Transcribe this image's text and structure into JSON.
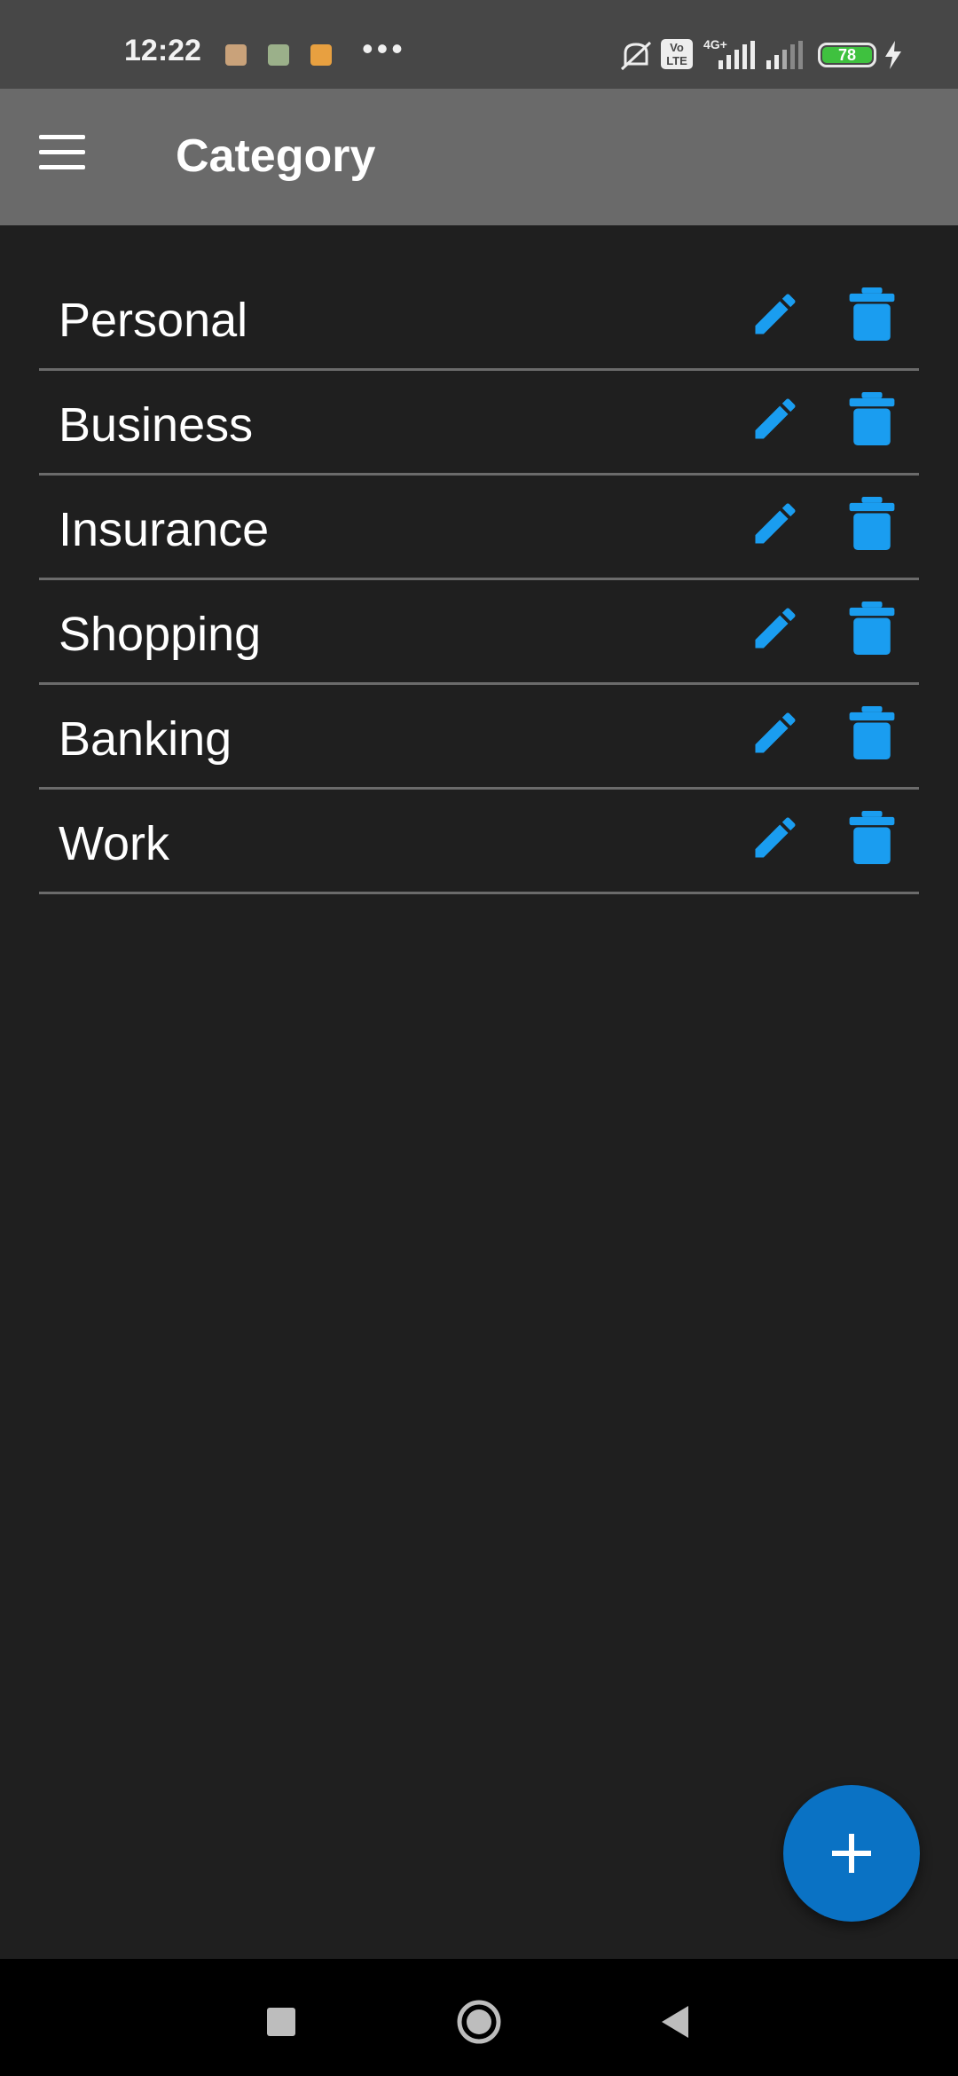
{
  "status_bar": {
    "time": "12:22",
    "more": "•••",
    "battery": "78",
    "network": "4G+",
    "volte_top": "Vo",
    "volte_bottom": "LTE"
  },
  "app_bar": {
    "title": "Category",
    "menu_icon": "hamburger-icon"
  },
  "categories": [
    {
      "label": "Personal"
    },
    {
      "label": "Business"
    },
    {
      "label": "Insurance"
    },
    {
      "label": "Shopping"
    },
    {
      "label": "Banking"
    },
    {
      "label": "Work"
    }
  ],
  "row_icons": {
    "edit": "pencil-icon",
    "delete": "trash-icon"
  },
  "fab": {
    "icon": "plus-icon"
  },
  "colors": {
    "accent": "#1a9df0",
    "fab": "#0a72c4",
    "app_bar": "#6a6a6a",
    "background": "#1f1f1f"
  }
}
